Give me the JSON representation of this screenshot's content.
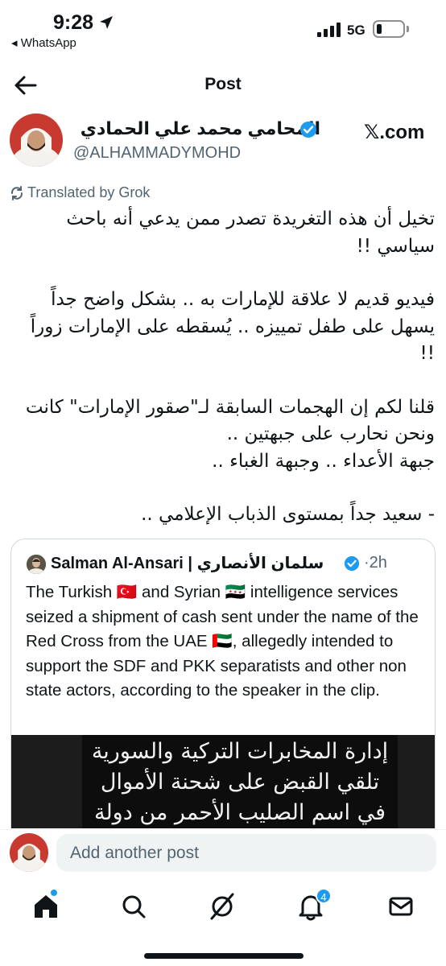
{
  "status_bar": {
    "time": "9:28",
    "back_app": "◂ WhatsApp",
    "network": "5G"
  },
  "nav": {
    "title": "Post"
  },
  "post": {
    "author_name": "المحامي محمد علي الحمادي",
    "handle": "@ALHAMMADYMOHD",
    "source": ".com",
    "translated_label": "Translated by Grok",
    "paragraphs": [
      "تخيل أن هذه التغريدة تصدر ممن يدعي أنه باحث سياسي !!",
      "فيديو قديم لا علاقة للإمارات به .. بشكل واضح جداً يسهل على طفل تمييزه .. يُسقطه على الإمارات زوراً !!",
      "قلنا لكم إن الهجمات السابقة لـ\"صقور الإمارات\" كانت ونحن نحارب على جبهتين ..\nجبهة الأعداء .. وجبهة الغباء ..",
      "- سعيد جداً بمستوى الذباب الإعلامي .."
    ]
  },
  "quote": {
    "name": "Salman Al-Ansari | سلمان الأنصاري",
    "time": "·2h",
    "text": "The Turkish 🇹🇷 and Syrian 🇸🇾 intelligence services seized a shipment of cash sent under the name of the Red Cross from the UAE 🇦🇪, allegedly intended to support the SDF and PKK separatists and other non state actors, according to the speaker in the clip.",
    "video_caption": "إدارة المخابرات التركية والسورية\nتلقي القبض على شحنة الأموال\nفي اسم الصليب الأحمر من دولة"
  },
  "reply": {
    "placeholder": "Add another post"
  },
  "tabbar": {
    "notifications_count": "4",
    "items": [
      "home-icon",
      "search-icon",
      "grok-icon",
      "notifications-icon",
      "messages-icon"
    ]
  },
  "colors": {
    "accent": "#1d9bf0",
    "text": "#0f1419",
    "secondary": "#536471"
  }
}
